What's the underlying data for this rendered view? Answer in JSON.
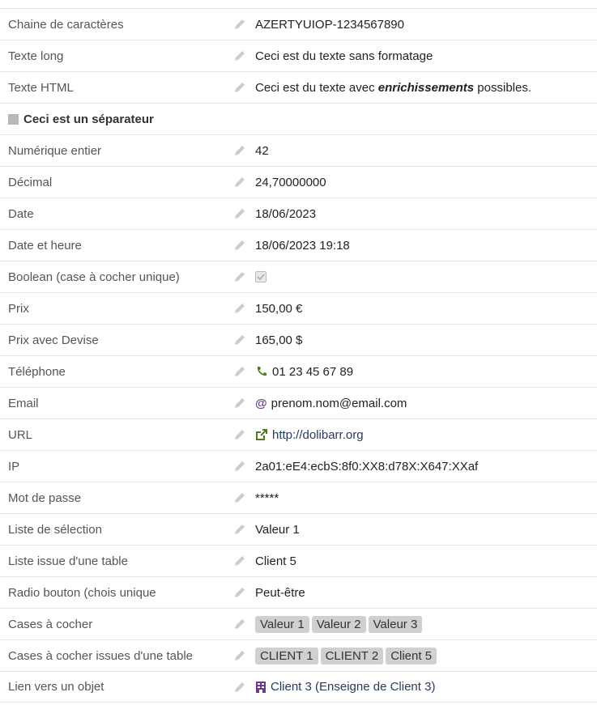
{
  "fields": [
    {
      "label": "Chaine de caractères",
      "value": "AZERTYUIOP-1234567890"
    },
    {
      "label": "Texte long",
      "value": "Ceci est du texte sans formatage"
    },
    {
      "label": "Texte HTML",
      "value_pre": "Ceci est du texte avec ",
      "value_em": "enrichissements",
      "value_post": " possibles."
    },
    {
      "label": "Numérique entier",
      "value": "42"
    },
    {
      "label": "Décimal",
      "value": "24,70000000"
    },
    {
      "label": "Date",
      "value": "18/06/2023"
    },
    {
      "label": "Date et heure",
      "value": "18/06/2023 19:18"
    },
    {
      "label": "Boolean (case à cocher unique)",
      "value": "checked"
    },
    {
      "label": "Prix",
      "value": "150,00 €"
    },
    {
      "label": "Prix avec Devise",
      "value": "165,00 $"
    },
    {
      "label": "Téléphone",
      "value": "01 23 45 67 89",
      "icon": "phone-icon"
    },
    {
      "label": "Email",
      "value": "prenom.nom@email.com",
      "icon": "at-icon"
    },
    {
      "label": "URL",
      "value": "http://dolibarr.org",
      "icon": "external-link-icon"
    },
    {
      "label": "IP",
      "value": "2a01:eE4:ecbS:8f0:XX8:d78X:X647:XXaf"
    },
    {
      "label": "Mot de passe",
      "value": "*****"
    },
    {
      "label": "Liste de sélection",
      "value": "Valeur 1"
    },
    {
      "label": "Liste issue d'une table",
      "value": "Client 5"
    },
    {
      "label": "Radio bouton (chois unique",
      "value": "Peut-être"
    },
    {
      "label": "Cases à cocher",
      "tags": [
        "Valeur 1",
        "Valeur 2",
        "Valeur 3"
      ]
    },
    {
      "label": "Cases à cocher issues d'une table",
      "tags": [
        "CLIENT 1",
        "CLIENT 2",
        "Client 5"
      ]
    },
    {
      "label": "Lien vers un objet",
      "value": "Client 3 (Enseigne de Client 3)",
      "icon": "building-icon"
    }
  ],
  "separator": {
    "label": "Ceci est un séparateur"
  },
  "colors": {
    "icon_green": "#55792a",
    "icon_purple": "#6b3a8b",
    "link_blue": "#263c5c",
    "tag_bg": "#d0d0d0"
  }
}
